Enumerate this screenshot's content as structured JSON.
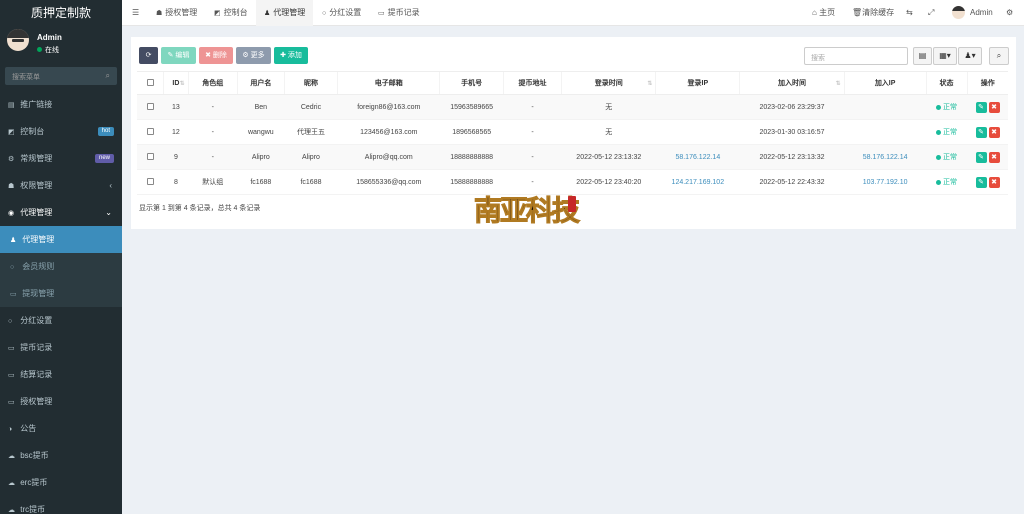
{
  "app": {
    "title": "质押定制款"
  },
  "user": {
    "name": "Admin",
    "status": "在线"
  },
  "sidebar": {
    "search_placeholder": "搜索菜单",
    "items": [
      {
        "label": "推广链接",
        "icon": "list-icon"
      },
      {
        "label": "控制台",
        "icon": "dashboard-icon",
        "badge": "hot",
        "badge_color": "#3c8dbc"
      },
      {
        "label": "常规管理",
        "icon": "cogs-icon",
        "badge": "new",
        "badge_color": "#605ca8"
      },
      {
        "label": "权限管理",
        "icon": "group-icon",
        "arrow": "‹"
      },
      {
        "label": "代理管理",
        "icon": "user-circle-icon",
        "arrow": "⌄"
      },
      {
        "label": "代理管理",
        "icon": "user-icon"
      },
      {
        "label": "会员规则",
        "icon": "circle-icon"
      },
      {
        "label": "提现管理",
        "icon": "card-icon"
      },
      {
        "label": "分红设置",
        "icon": "circle-icon"
      },
      {
        "label": "提币记录",
        "icon": "card-icon"
      },
      {
        "label": "结算记录",
        "icon": "card-icon"
      },
      {
        "label": "授权管理",
        "icon": "card-icon"
      },
      {
        "label": "公告",
        "icon": "pie-icon"
      },
      {
        "label": "bsc提币",
        "icon": "cloud-icon"
      },
      {
        "label": "erc提币",
        "icon": "cloud-icon"
      },
      {
        "label": "trc提币",
        "icon": "cloud-icon"
      }
    ]
  },
  "topbar": {
    "tabs": [
      {
        "label": "授权管理",
        "icon": "users-icon"
      },
      {
        "label": "控制台",
        "icon": "dashboard-icon"
      },
      {
        "label": "代理管理",
        "icon": "user-icon"
      },
      {
        "label": "分红设置",
        "icon": "circle-icon"
      },
      {
        "label": "提币记录",
        "icon": "card-icon"
      }
    ],
    "home": "主页",
    "clear_cache": "清除缓存",
    "admin": "Admin"
  },
  "toolbar": {
    "edit": "编辑",
    "delete": "删除",
    "more": "更多",
    "add": "添加",
    "search_placeholder": "搜索"
  },
  "table": {
    "headers": [
      "ID",
      "角色组",
      "用户名",
      "昵称",
      "电子邮箱",
      "手机号",
      "提币地址",
      "登录时间",
      "登录IP",
      "加入时间",
      "加入IP",
      "状态",
      "操作"
    ],
    "rows": [
      {
        "id": "13",
        "group": "-",
        "username": "Ben",
        "nickname": "Cedric",
        "email": "foreign86@163.com",
        "phone": "15963589665",
        "address": "-",
        "login_time": "无",
        "login_ip": "",
        "join_time": "2023-02-06 23:29:37",
        "join_ip": "",
        "status": "正常"
      },
      {
        "id": "12",
        "group": "-",
        "username": "wangwu",
        "nickname": "代理王五",
        "email": "123456@163.com",
        "phone": "1896568565",
        "address": "-",
        "login_time": "无",
        "login_ip": "",
        "join_time": "2023-01-30 03:16:57",
        "join_ip": "",
        "status": "正常"
      },
      {
        "id": "9",
        "group": "-",
        "username": "Alipro",
        "nickname": "Alipro",
        "email": "Alipro@qq.com",
        "phone": "18888888888",
        "address": "-",
        "login_time": "2022-05-12 23:13:32",
        "login_ip": "58.176.122.14",
        "join_time": "2022-05-12 23:13:32",
        "join_ip": "58.176.122.14",
        "status": "正常"
      },
      {
        "id": "8",
        "group": "默认组",
        "username": "fc1688",
        "nickname": "fc1688",
        "email": "158655336@qq.com",
        "phone": "15888888888",
        "address": "-",
        "login_time": "2022-05-12 23:40:20",
        "login_ip": "124.217.169.102",
        "join_time": "2022-05-12 22:43:32",
        "join_ip": "103.77.192.10",
        "status": "正常"
      }
    ],
    "footer": "显示第 1 到第 4 条记录，总共 4 条记录"
  },
  "watermark": {
    "text": "南亚科技"
  }
}
